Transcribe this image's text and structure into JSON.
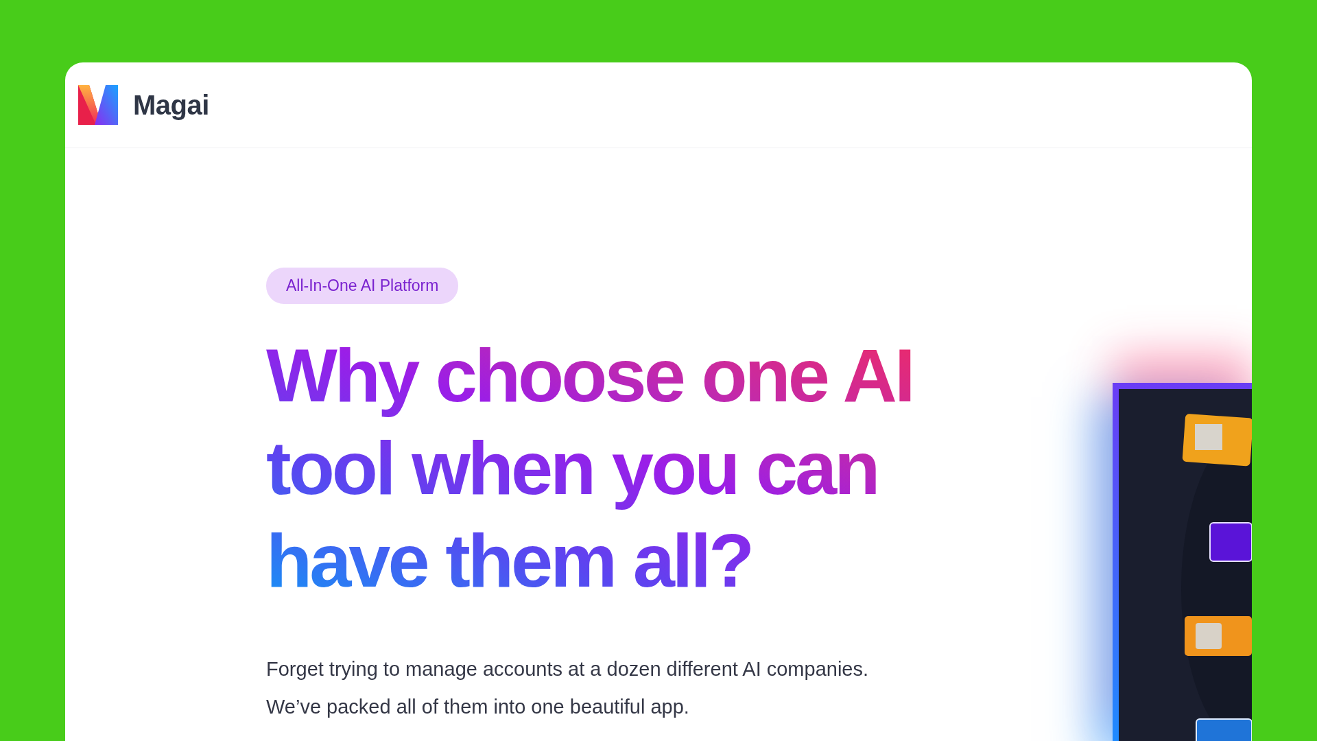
{
  "header": {
    "brand": "Magai"
  },
  "hero": {
    "badge": "All-In-One AI Platform",
    "headline": [
      "Why choose one AI",
      "tool when you can",
      "have them all?"
    ],
    "description": "Forget trying to manage accounts at a dozen different AI companies. We’ve packed all of them into one beautiful app."
  }
}
